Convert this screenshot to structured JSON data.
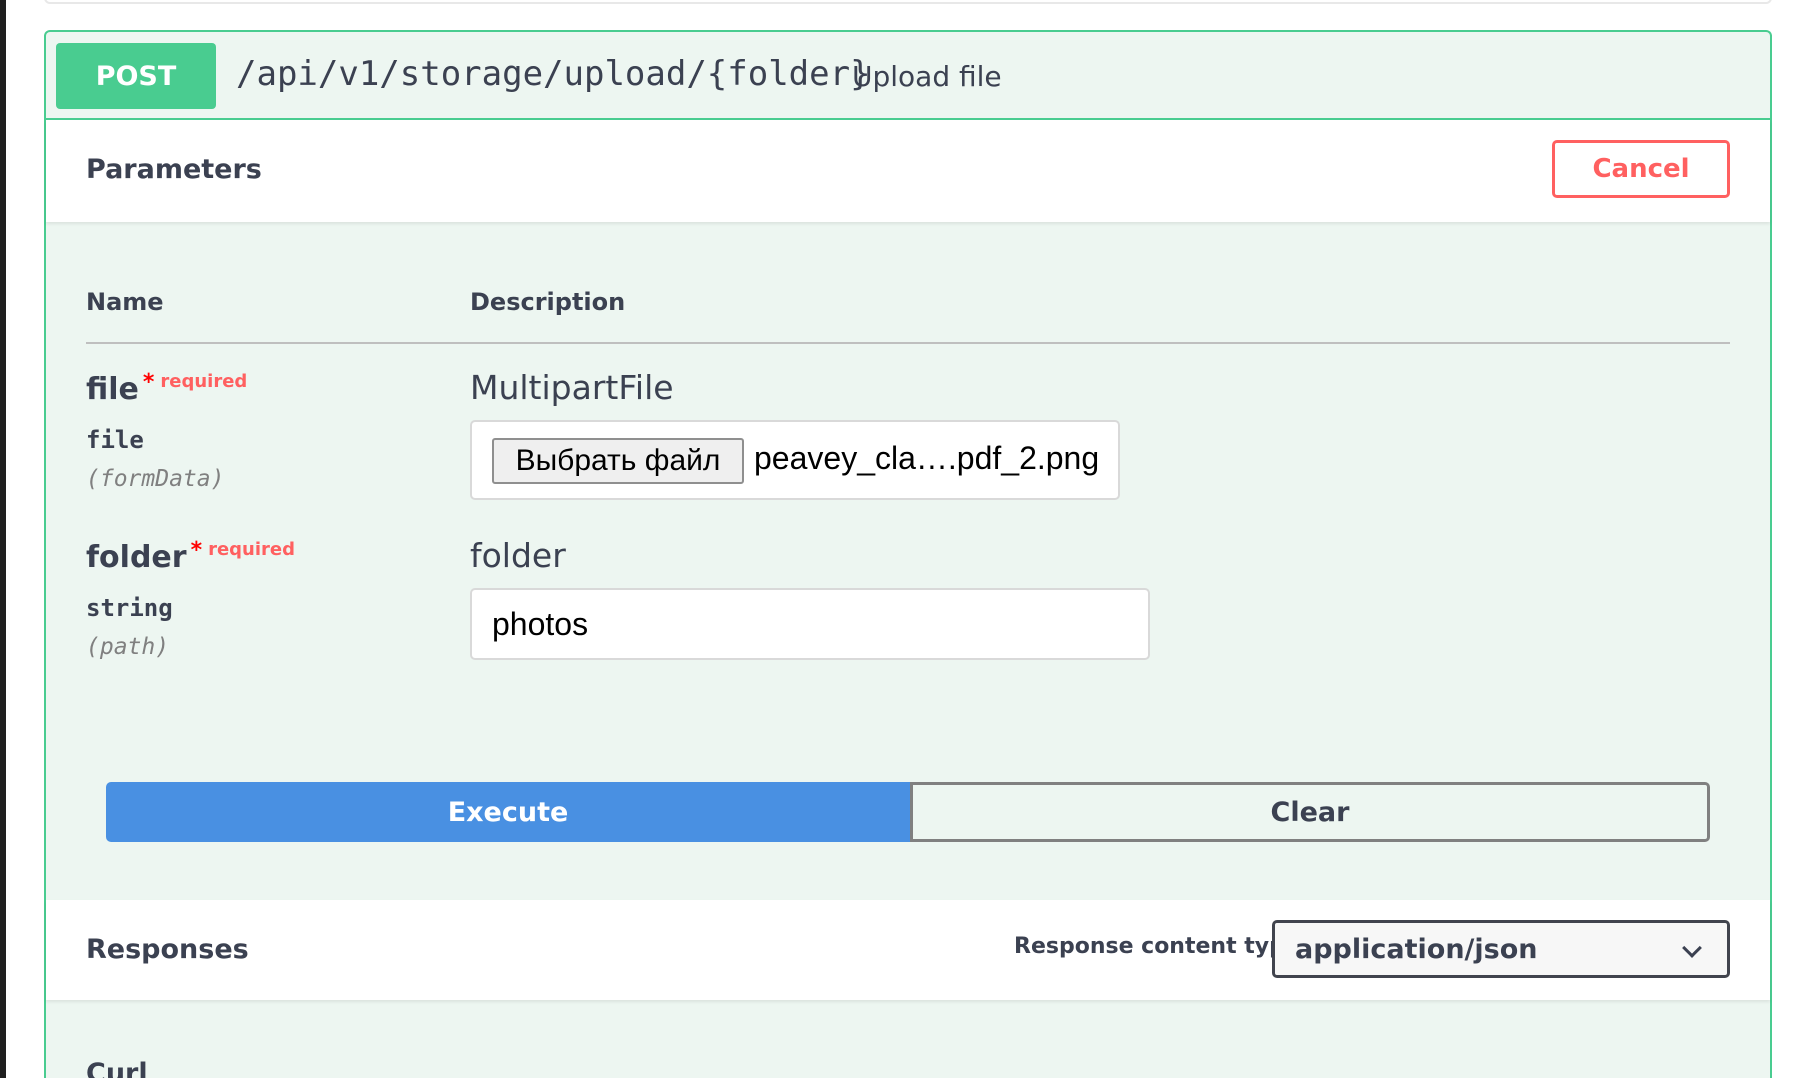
{
  "operation": {
    "method": "POST",
    "path": "/api/v1/storage/upload/{folder}",
    "summary": "Upload file"
  },
  "parameters": {
    "title": "Parameters",
    "cancel_label": "Cancel",
    "col_name": "Name",
    "col_description": "Description",
    "items": [
      {
        "name": "file",
        "required_star": "*",
        "required_label": "required",
        "type": "file",
        "in": "(formData)",
        "description": "MultipartFile",
        "choose_file_label": "Выбрать файл",
        "file_name": "peavey_cla….pdf_2.png"
      },
      {
        "name": "folder",
        "required_star": "*",
        "required_label": "required",
        "type": "string",
        "in": "(path)",
        "description": "folder",
        "value": "photos"
      }
    ]
  },
  "actions": {
    "execute_label": "Execute",
    "clear_label": "Clear"
  },
  "responses": {
    "title": "Responses",
    "content_type_label": "Response content type",
    "content_type_value": "application/json"
  },
  "curl": {
    "title": "Curl"
  },
  "colors": {
    "post_green": "#49cc90",
    "block_bg": "#edf6f1",
    "execute_blue": "#4990e2",
    "cancel_red": "#ff6060"
  }
}
